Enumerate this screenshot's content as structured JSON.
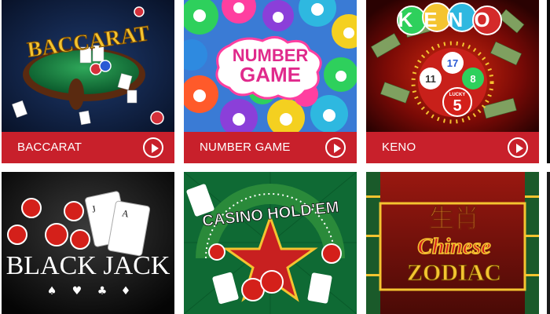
{
  "games": [
    {
      "label": "BACCARAT",
      "logo": "BACCARAT",
      "button": "play-icon"
    },
    {
      "label": "NUMBER GAME",
      "logo_line1": "NUMBER",
      "logo_line2": "GAME",
      "button": "play-icon"
    },
    {
      "label": "KENO",
      "logo": "KENO",
      "ball_numbers": [
        "17",
        "11",
        "5",
        "8"
      ],
      "lucky_text": "LUCKY",
      "button": "play-icon"
    },
    {
      "label": "",
      "logo": "BLACK JACK"
    },
    {
      "label": "",
      "logo": "CASINO HOLD'EM"
    },
    {
      "label": "",
      "logo_chinese": "生肖",
      "logo_line1": "Chinese",
      "logo_line2": "ZODIAC"
    }
  ],
  "colors": {
    "bar": "#c8202b",
    "background": "#ffffff"
  }
}
